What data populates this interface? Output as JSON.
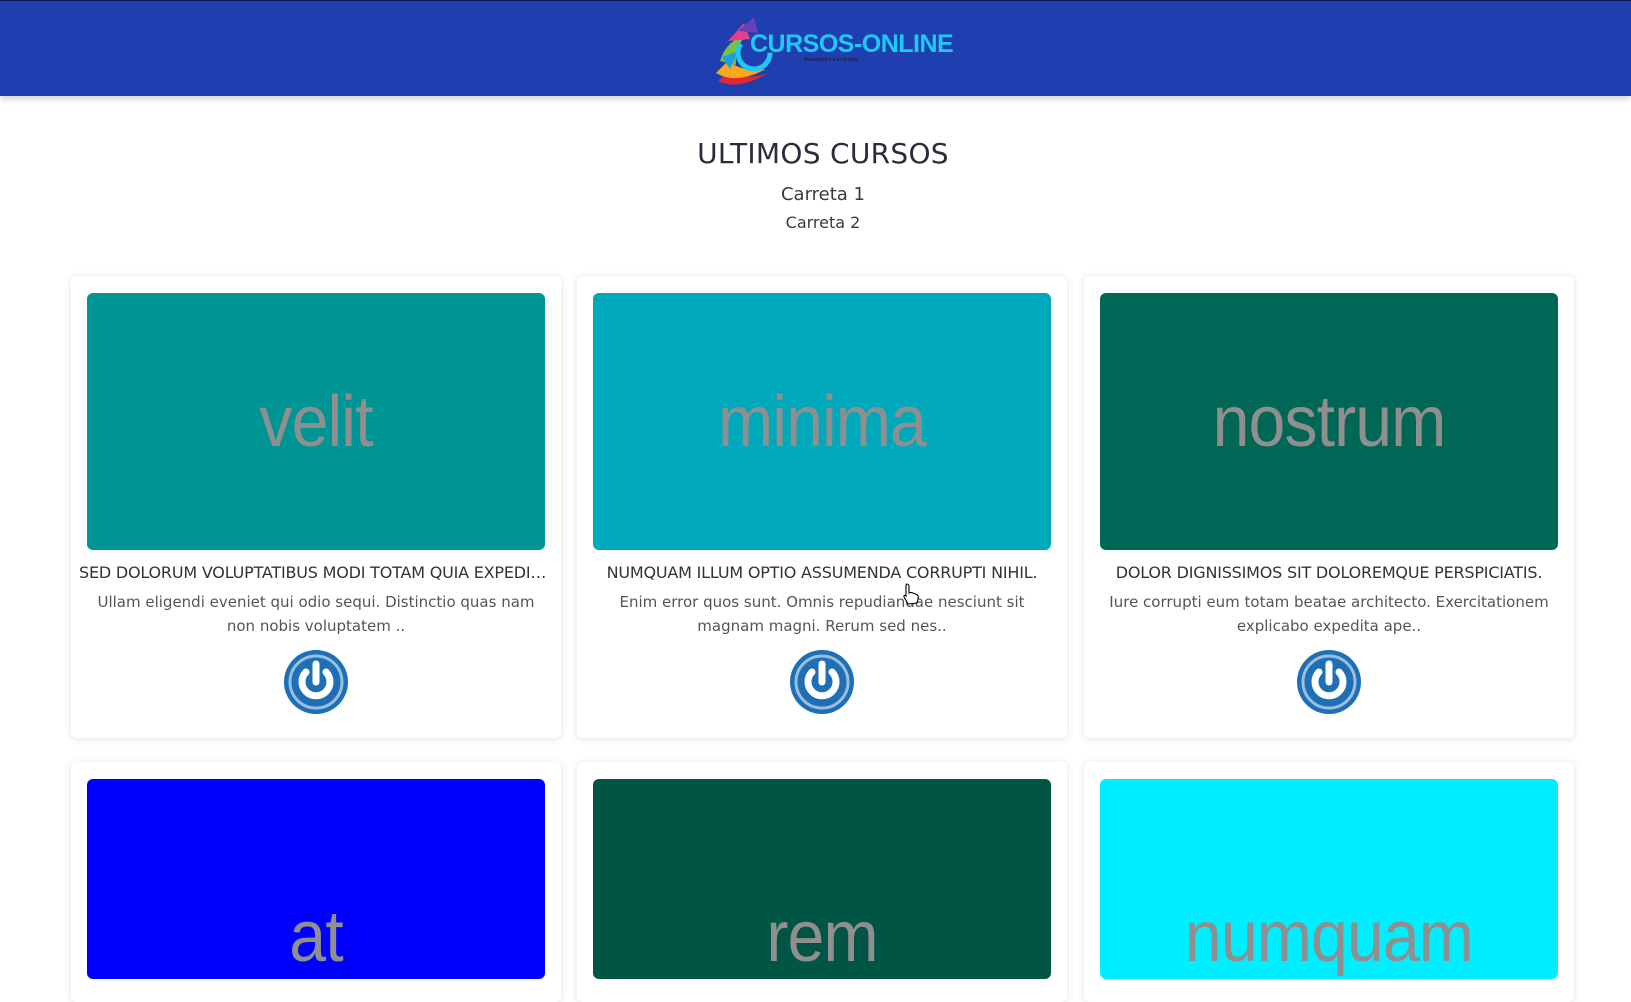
{
  "header": {
    "logo_text": "CURSOS-ONLINE",
    "logo_tagline": "Bienvenidos a tu destino"
  },
  "section": {
    "title": "ULTIMOS CURSOS",
    "subtitle1": "Carreta 1",
    "subtitle2": "Carreta 2"
  },
  "cards": [
    {
      "image_word": "velit",
      "image_color": "#009595",
      "title": "SED DOLORUM VOLUPTATIBUS MODI TOTAM QUIA EXPEDITA.",
      "text": "Ullam eligendi eveniet qui odio sequi. Distinctio quas nam non nobis voluptatem ..",
      "icon": "power-icon"
    },
    {
      "image_word": "minima",
      "image_color": "#00a8bb",
      "title": "NUMQUAM ILLUM OPTIO ASSUMENDA CORRUPTI NIHIL.",
      "text": "Enim error quos sunt. Omnis repudiandae nesciunt sit magnam magni. Rerum sed nes..",
      "icon": "power-icon"
    },
    {
      "image_word": "nostrum",
      "image_color": "#006655",
      "title": "DOLOR DIGNISSIMOS SIT DOLOREMQUE PERSPICIATIS.",
      "text": "Iure corrupti eum totam beatae architecto. Exercitationem explicabo expedita ape..",
      "icon": "power-icon"
    },
    {
      "image_word": "at",
      "image_color": "#0000ff"
    },
    {
      "image_word": "rem",
      "image_color": "#005544"
    },
    {
      "image_word": "numquam",
      "image_color": "#00eeff"
    }
  ],
  "colors": {
    "navbar": "#1f3fb0",
    "accent_button": "#1f6fb6",
    "logo_text": "#1ec9f5"
  }
}
